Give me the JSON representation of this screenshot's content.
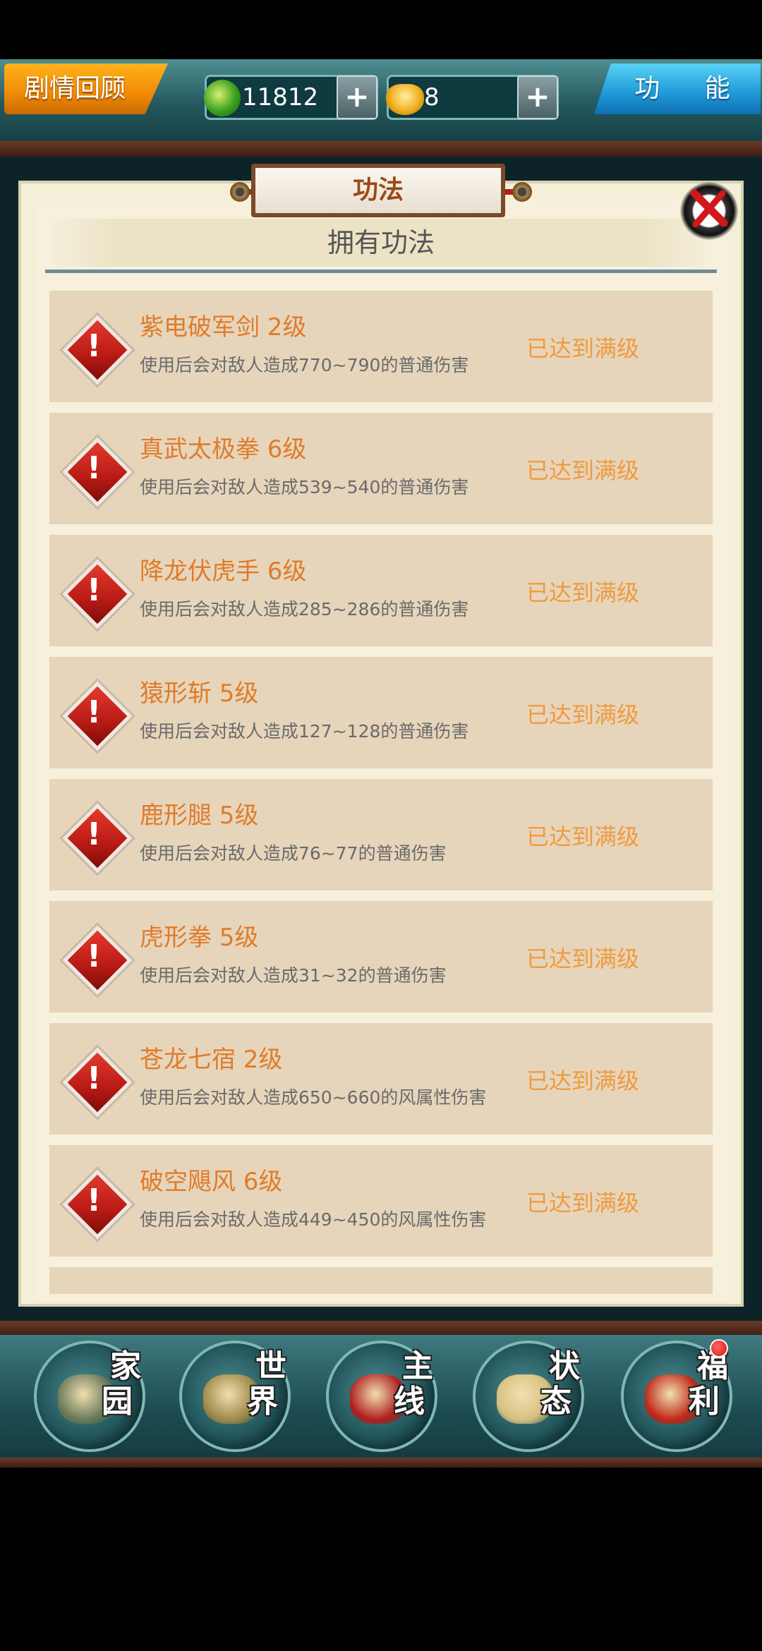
{
  "top_bar": {
    "story_button": "剧情回顾",
    "function_button": "功 能",
    "jade_amount": "11812",
    "gold_amount": "8",
    "plus_label": "+"
  },
  "panel": {
    "title": "功法",
    "header": "拥有功法"
  },
  "skills": [
    {
      "name": "紫电破军剑 2级",
      "desc": "使用后会对敌人造成770~790的普通伤害",
      "status": "已达到满级"
    },
    {
      "name": "真武太极拳 6级",
      "desc": "使用后会对敌人造成539~540的普通伤害",
      "status": "已达到满级"
    },
    {
      "name": "降龙伏虎手 6级",
      "desc": "使用后会对敌人造成285~286的普通伤害",
      "status": "已达到满级"
    },
    {
      "name": "猿形斩 5级",
      "desc": "使用后会对敌人造成127~128的普通伤害",
      "status": "已达到满级"
    },
    {
      "name": "鹿形腿 5级",
      "desc": "使用后会对敌人造成76~77的普通伤害",
      "status": "已达到满级"
    },
    {
      "name": "虎形拳 5级",
      "desc": "使用后会对敌人造成31~32的普通伤害",
      "status": "已达到满级"
    },
    {
      "name": "苍龙七宿 2级",
      "desc": "使用后会对敌人造成650~660的风属性伤害",
      "status": "已达到满级"
    },
    {
      "name": "破空飓风 6级",
      "desc": "使用后会对敌人造成449~450的风属性伤害",
      "status": "已达到满级"
    }
  ],
  "skill_icon": {
    "icon": "exclamation-diamond-icon",
    "glyph": "!"
  },
  "bottom_nav": [
    {
      "label": [
        "家",
        "园"
      ],
      "icon": "home-icon",
      "art_color": "#6a7a5a"
    },
    {
      "label": [
        "世",
        "界"
      ],
      "icon": "world-map-icon",
      "art_color": "#a08a4a"
    },
    {
      "label": [
        "主",
        "线"
      ],
      "icon": "main-quest-icon",
      "art_color": "#b02020"
    },
    {
      "label": [
        "状",
        "态"
      ],
      "icon": "bagua-icon",
      "art_color": "#d8c080"
    },
    {
      "label": [
        "福",
        "利"
      ],
      "icon": "welfare-bag-icon",
      "art_color": "#c02818"
    }
  ],
  "colors": {
    "skill_name": "#e07b2a",
    "status": "#f09a3e",
    "panel_bg": "#f5efd8",
    "row_bg": "#e6d5bb"
  }
}
